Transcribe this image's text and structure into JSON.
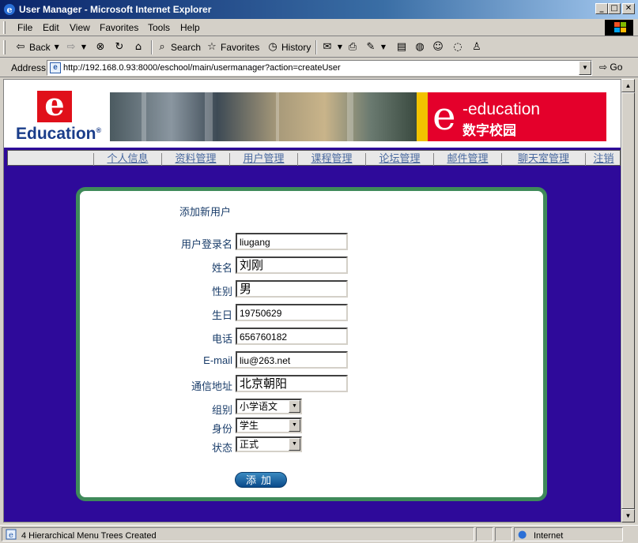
{
  "window": {
    "title": "User Manager - Microsoft Internet Explorer"
  },
  "menu": [
    "File",
    "Edit",
    "View",
    "Favorites",
    "Tools",
    "Help"
  ],
  "toolbar": {
    "back": "Back",
    "search": "Search",
    "favorites": "Favorites",
    "history": "History"
  },
  "address": {
    "label": "Address",
    "url": "http://192.168.0.93:8000/eschool/main/usermanager?action=createUser",
    "go": "Go"
  },
  "banner": {
    "logo_letter": "e",
    "logo_text": "Education",
    "brand_en": "-education",
    "brand_cn": "数字校园",
    "brand_letter": "e"
  },
  "nav": [
    "个人信息",
    "资料管理",
    "用户管理",
    "课程管理",
    "论坛管理",
    "邮件管理",
    "聊天室管理",
    "注销"
  ],
  "form": {
    "heading": "添加新用户",
    "fields": [
      {
        "label": "用户登录名",
        "value": "liugang"
      },
      {
        "label": "姓名",
        "value": "刘刚"
      },
      {
        "label": "性别",
        "value": "男"
      },
      {
        "label": "生日",
        "value": "19750629"
      },
      {
        "label": "电话",
        "value": "656760182"
      },
      {
        "label": "E-mail",
        "value": "liu@263.net"
      },
      {
        "label": "通信地址",
        "value": "北京朝阳"
      }
    ],
    "selects": [
      {
        "label": "组别",
        "value": "小学语文"
      },
      {
        "label": "身份",
        "value": "学生"
      },
      {
        "label": "状态",
        "value": "正式"
      }
    ],
    "submit": "添加"
  },
  "status": {
    "text": "4 Hierarchical Menu Trees Created",
    "zone": "Internet"
  }
}
